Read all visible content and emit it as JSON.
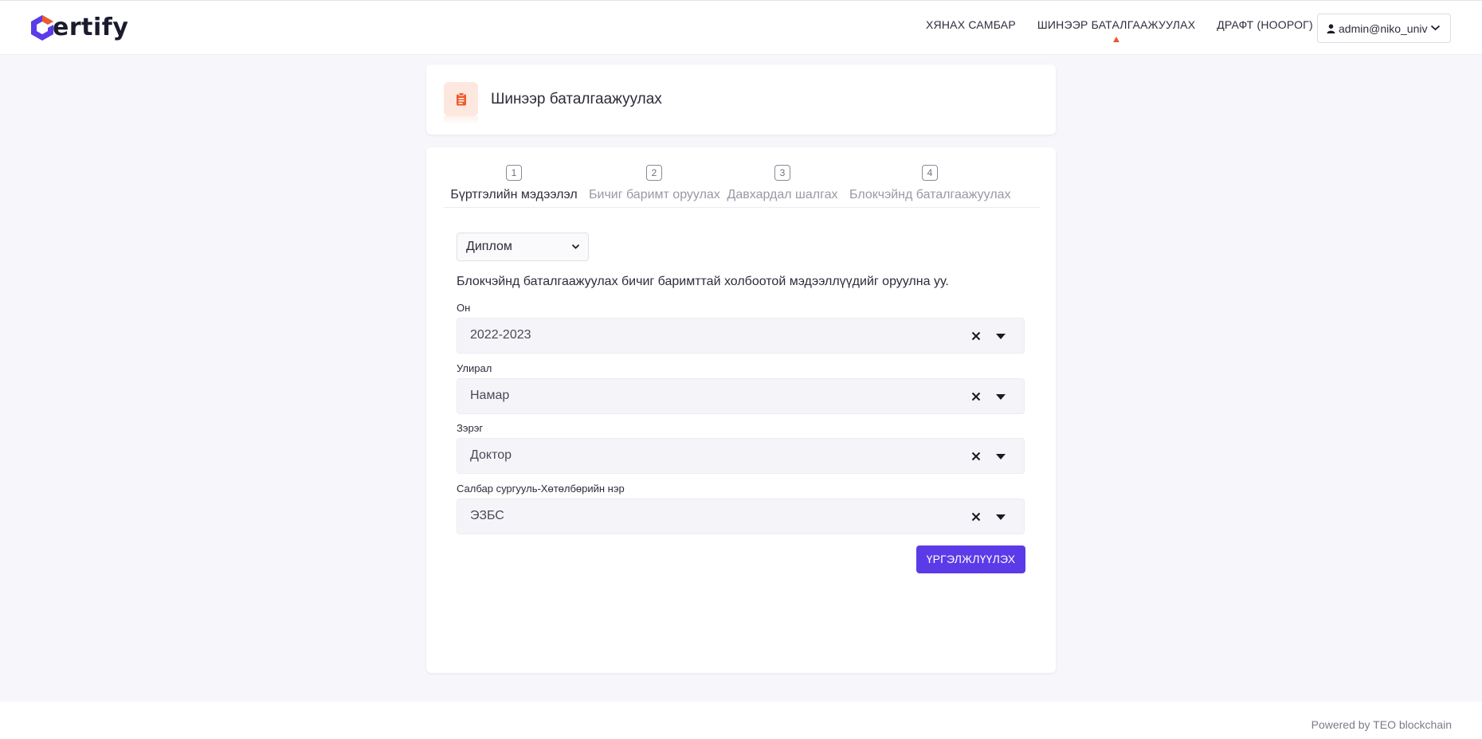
{
  "app": {
    "logo_text": "ertify",
    "brand_colors": {
      "logo_primary": "#5b3be8",
      "logo_accent": "#ee5a2b",
      "primary_button": "#5b3be8"
    }
  },
  "nav": {
    "items": [
      {
        "label": "ХЯНАХ САМБАР",
        "active": false
      },
      {
        "label": "ШИНЭЭР БАТАЛГААЖУУЛАХ",
        "active": true
      },
      {
        "label": "ДРАФТ (НООРОГ)",
        "active": false
      }
    ],
    "user": {
      "label": "admin@niko_univ",
      "icon": "user-icon"
    }
  },
  "page": {
    "title": "Шинээр баталгаажуулах",
    "title_icon": "clipboard-icon"
  },
  "steps": [
    {
      "number": "1",
      "label": "Бүртгэлийн мэдээлэл",
      "active": true
    },
    {
      "number": "2",
      "label": "Бичиг баримт оруулах",
      "active": false
    },
    {
      "number": "3",
      "label": "Давхардал шалгах",
      "active": false
    },
    {
      "number": "4",
      "label": "Блокчэйнд баталгаажуулах",
      "active": false
    }
  ],
  "form": {
    "document_type": {
      "selected": "Диплом"
    },
    "hint": "Блокчэйнд баталгаажуулах бичиг баримттай холбоотой мэдээллүүдийг оруулна уу.",
    "fields": [
      {
        "label": "Он",
        "value": "2022-2023"
      },
      {
        "label": "Улирал",
        "value": "Намар"
      },
      {
        "label": "Зэрэг",
        "value": "Доктор"
      },
      {
        "label": "Салбар сургууль-Хөтөлбөрийн нэр",
        "value": "ЭЗБС"
      }
    ],
    "continue_label": "ҮРГЭЛЖЛҮҮЛЭХ"
  },
  "footer": {
    "powered_by": "Powered by TEO blockchain"
  }
}
